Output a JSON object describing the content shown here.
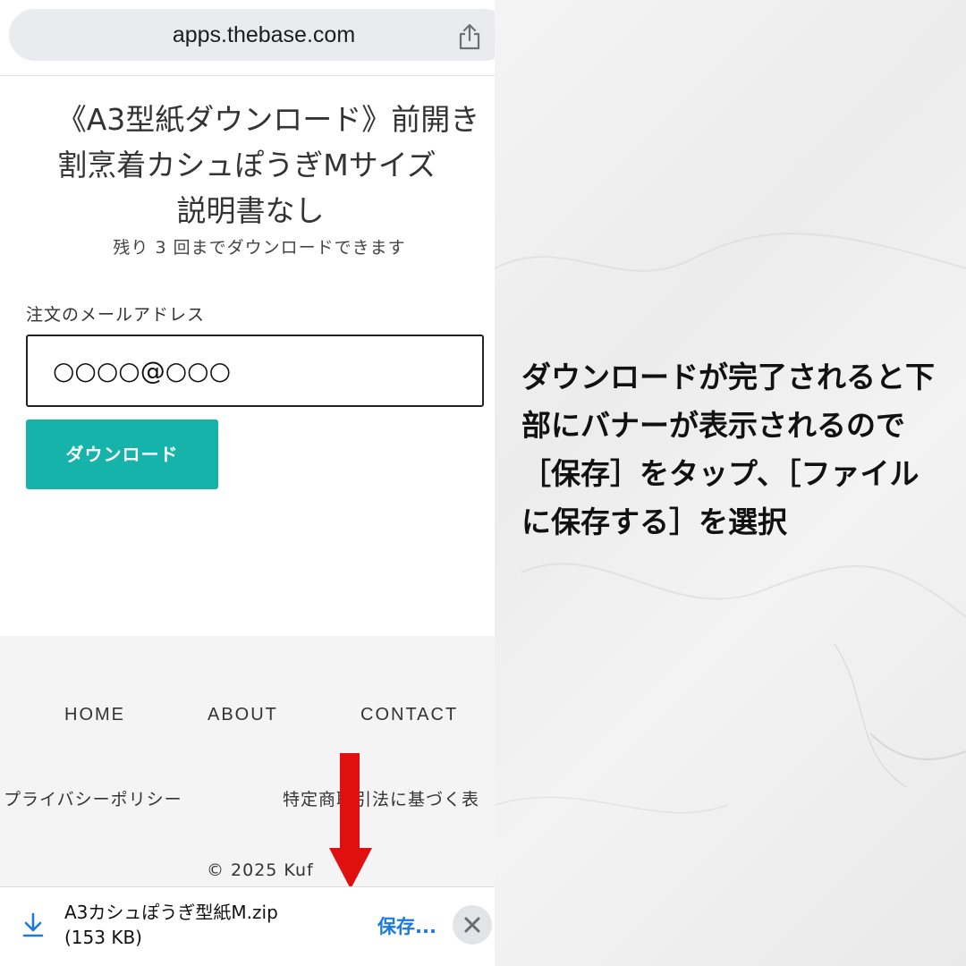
{
  "browser": {
    "url": "apps.thebase.com",
    "share_icon": "share-icon"
  },
  "product": {
    "title_line1": "《A3型紙ダウンロード》前開き",
    "title_line2": "割烹着カシュぽうぎMサイズ",
    "title_line3": "説明書なし",
    "remaining": "残り 3 回までダウンロードできます"
  },
  "form": {
    "email_label": "注文のメールアドレス",
    "email_value": "○○○○@○○○",
    "download_label": "ダウンロード"
  },
  "footer": {
    "nav": [
      "HOME",
      "ABOUT",
      "CONTACT"
    ],
    "privacy": "プライバシーポリシー",
    "legal": "特定商取引法に基づく表",
    "copyright": "© 2025 Kuf"
  },
  "download_banner": {
    "file_name": "A3カシュぽうぎ型紙M.zip",
    "file_size": "(153 KB)",
    "save_label": "保存...",
    "icons": [
      "download-icon",
      "close-icon"
    ],
    "accent": "#1a7ae0"
  },
  "annotation": {
    "line1": "ダウンロードが完了されると下",
    "line2": "部にバナーが表示されるので",
    "line3": "［保存］をタップ、［ファイル",
    "line4": "に保存する］を選択"
  },
  "colors": {
    "button": "#15b3aa",
    "arrow": "#e01010",
    "footer_bg": "#f4f4f4"
  }
}
